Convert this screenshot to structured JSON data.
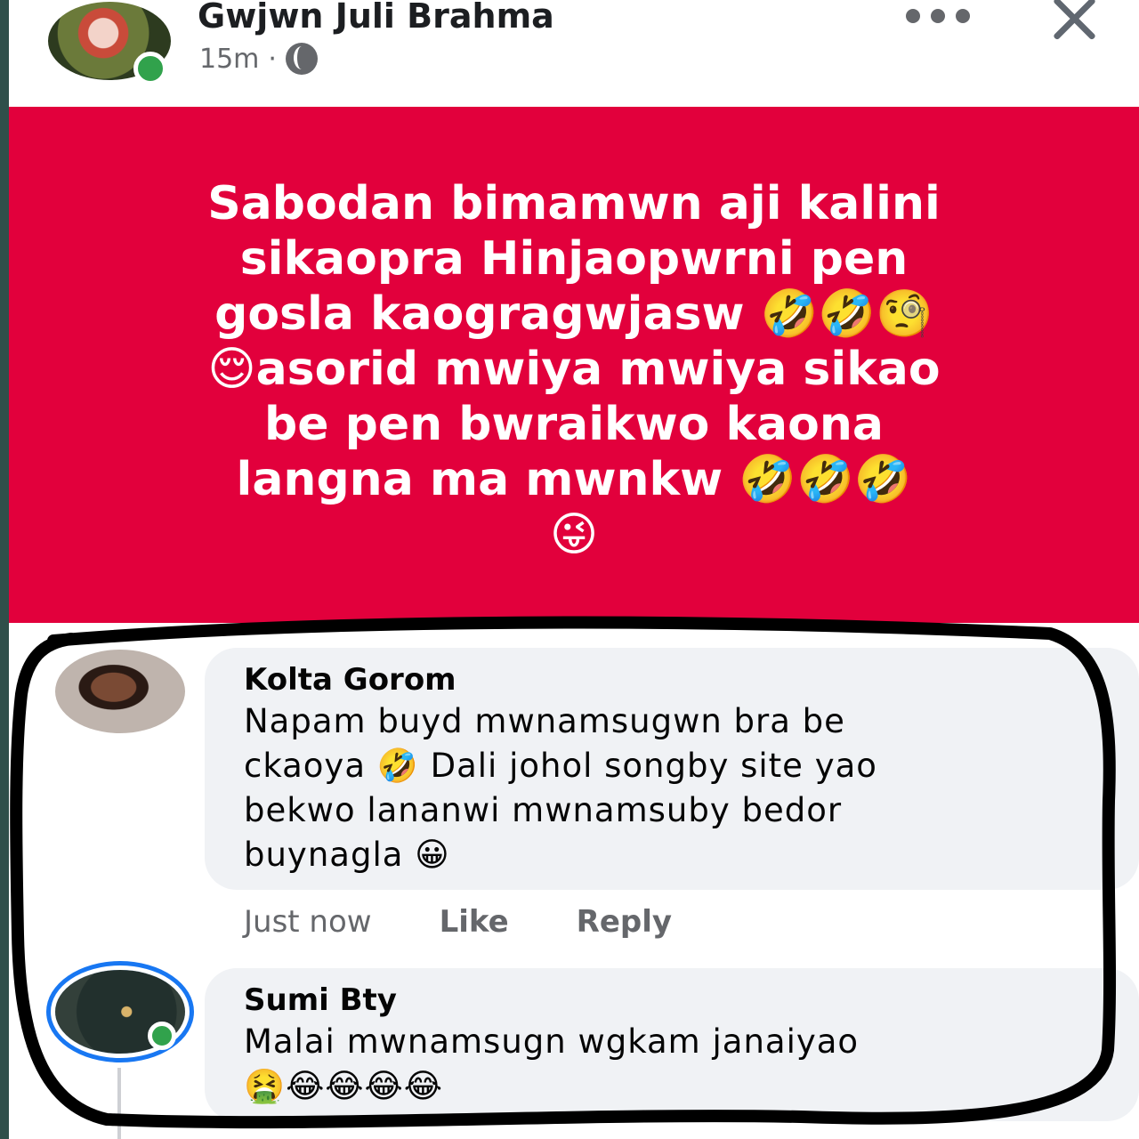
{
  "post": {
    "author": "Gwjwn Juli Brahma",
    "time": "15m",
    "separator": "·",
    "privacy_icon": "globe-icon",
    "more_icon": "more-dots-icon",
    "close_icon": "close-icon",
    "background_color": "#e2003c",
    "body": "Sabodan bimamwn aji kalini\nsikaopra Hinjaopwrni pen\ngosla kaogragwjasw 🤣🤣🧐\n😌asorid mwiya mwiya sikao\nbe pen bwraikwo kaona\nlangna ma mwnkw 🤣🤣🤣\n😜"
  },
  "comments": [
    {
      "author": "Kolta Gorom",
      "text": "Napam  buyd mwnamsugwn  bra be\nckaoya 🤣 Dali johol songby site yao\nbekwo lananwi mwnamsuby    bedor\nbuynagla 😀",
      "time": "Just now",
      "like_label": "Like",
      "reply_label": "Reply"
    },
    {
      "author": "Sumi Bty",
      "text": "Malai mwnamsugn wgkam janaiyao\n🤮😂😂😂😂"
    }
  ],
  "colors": {
    "online": "#31a24c",
    "story_ring": "#1877f2",
    "bubble": "#f0f2f5",
    "highlight_stroke": "#000000"
  }
}
